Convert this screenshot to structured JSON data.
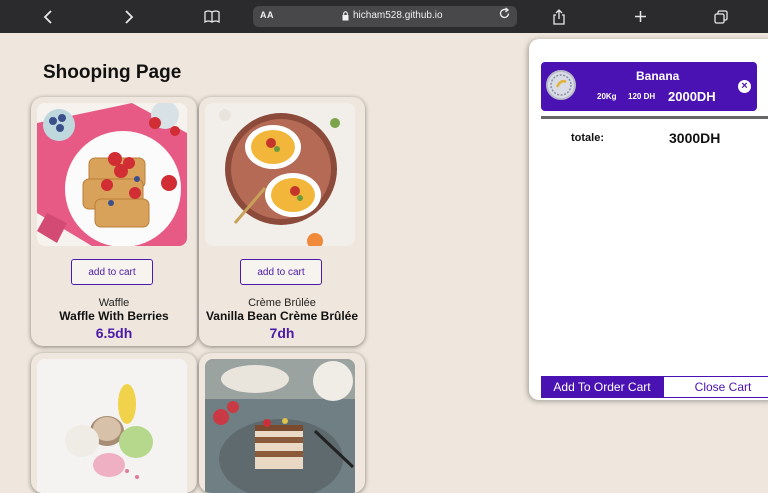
{
  "browser": {
    "text_size_label": "AA",
    "url": "hicham528.github.io"
  },
  "page": {
    "title": "Shooping Page"
  },
  "products": [
    {
      "category": "Waffle",
      "name": "Waffle With Berries",
      "price": "6.5dh",
      "button": "add to cart"
    },
    {
      "category": "Crème Brûlée",
      "name": "Vanilla Bean Crème Brûlée",
      "price": "7dh",
      "button": "add to cart"
    }
  ],
  "cart": {
    "item": {
      "name": "Banana",
      "weight": "20Kg",
      "unit_price": "120 DH",
      "total": "2000DH"
    },
    "total_label": "totale:",
    "total_value": "3000DH",
    "order_button": "Add To Order Cart",
    "close_button": "Close Cart"
  },
  "colors": {
    "accent": "#4b12b3",
    "background": "#efe7dd",
    "toolbar": "#2b2b2d"
  },
  "icons": [
    "back-icon",
    "forward-icon",
    "reader-icon",
    "lock-icon",
    "reload-icon",
    "share-icon",
    "new-tab-icon",
    "tabs-icon",
    "remove-item-icon"
  ]
}
